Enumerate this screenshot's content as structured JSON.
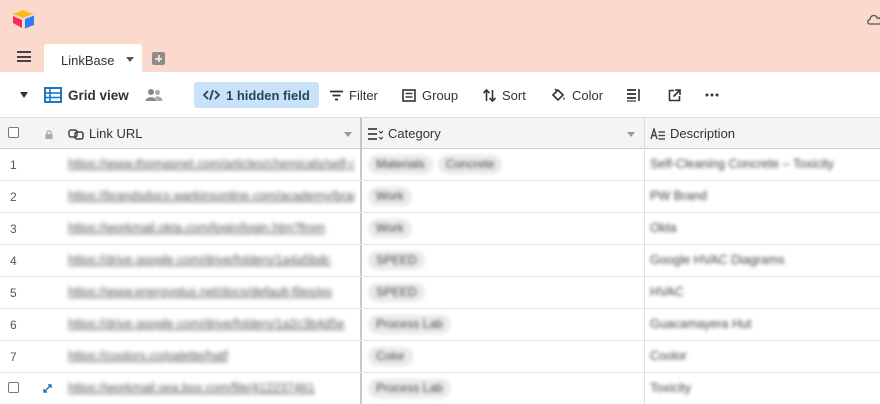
{
  "app": {
    "tab_name": "LinkBase"
  },
  "toolbar": {
    "view_name": "Grid view",
    "hidden_fields": "1 hidden field",
    "filter": "Filter",
    "group": "Group",
    "sort": "Sort",
    "color": "Color"
  },
  "columns": {
    "link_url": "Link URL",
    "category": "Category",
    "description": "Description"
  },
  "rows": [
    {
      "num": "1",
      "url": "https://www.thomasnet.com/articles/chemicals/self-cleaning",
      "tags": [
        "Materials",
        "Concrete"
      ],
      "description": "Self-Cleaning Concrete – Toxicity"
    },
    {
      "num": "2",
      "url": "https://brandsdocs.warkinsonline.com/academy/brand",
      "tags": [
        "Work"
      ],
      "description": "PW Brand"
    },
    {
      "num": "3",
      "url": "https://workmail.okta.com/login/login.htm?from",
      "tags": [
        "Work"
      ],
      "description": "Okta"
    },
    {
      "num": "4",
      "url": "https://drive.google.com/drive/folders/1a4a5bdc",
      "tags": [
        "SPEED"
      ],
      "description": "Google HVAC Diagrams"
    },
    {
      "num": "5",
      "url": "https://www.energyplus.net/docs/default-files/ep",
      "tags": [
        "SPEED"
      ],
      "description": "HVAC"
    },
    {
      "num": "6",
      "url": "https://drive.google.com/drive/folders/1a2c3b4d5e",
      "tags": [
        "Process Lab"
      ],
      "description": "Guacamayera Hut"
    },
    {
      "num": "7",
      "url": "https://coolors.co/palette/hatf",
      "tags": [
        "Color"
      ],
      "description": "Coolor"
    },
    {
      "num": "",
      "url": "https://workmail.sea.box.com/file/412237461",
      "tags": [
        "Process Lab"
      ],
      "description": "Toxicity"
    }
  ]
}
